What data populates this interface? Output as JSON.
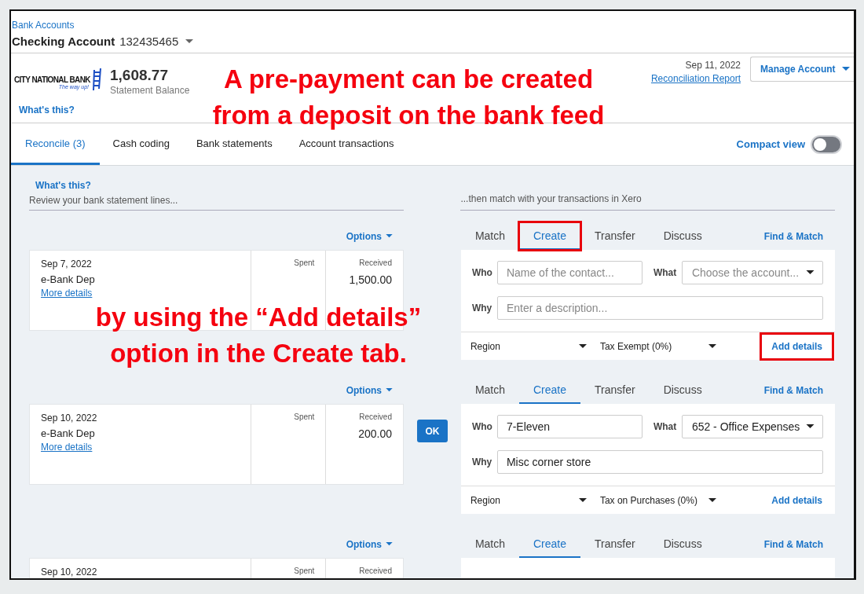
{
  "breadcrumb": "Bank Accounts",
  "account": {
    "name": "Checking Account",
    "number": "132435465"
  },
  "bank": {
    "logo_text": "CITY NATIONAL BANK",
    "tagline": "The way up!",
    "balance": "1,608.77",
    "balance_label": "Statement Balance",
    "help": "What's this?"
  },
  "statement": {
    "date": "Sep 11, 2022",
    "report_link": "Reconciliation Report",
    "manage_button": "Manage Account"
  },
  "tabs": [
    {
      "label": "Reconcile (3)",
      "selected": true
    },
    {
      "label": "Cash coding",
      "selected": false
    },
    {
      "label": "Bank statements",
      "selected": false
    },
    {
      "label": "Account transactions",
      "selected": false
    }
  ],
  "compact_view": {
    "label": "Compact view",
    "on": false
  },
  "left_help": "What's this?",
  "left_heading": "Review your bank statement lines...",
  "right_heading": "...then match with your transactions in Xero",
  "lines": [
    {
      "options": "Options",
      "date": "Sep 7, 2022",
      "description": "e-Bank Dep",
      "more": "More details",
      "spent_label": "Spent",
      "received_label": "Received",
      "received": "1,500.00",
      "match": {
        "tabs": [
          {
            "label": "Match",
            "selected": false,
            "highlighted": false
          },
          {
            "label": "Create",
            "selected": true,
            "highlighted": true
          },
          {
            "label": "Transfer",
            "selected": false,
            "highlighted": false
          },
          {
            "label": "Discuss",
            "selected": false,
            "highlighted": false
          }
        ],
        "find": "Find & Match",
        "who": {
          "label": "Who",
          "placeholder": "Name of the contact..."
        },
        "what": {
          "label": "What",
          "placeholder": "Choose the account..."
        },
        "why": {
          "label": "Why",
          "placeholder": "Enter a description..."
        },
        "region": "Region",
        "tax": "Tax Exempt (0%)",
        "add_details": {
          "label": "Add details",
          "highlighted": true
        }
      }
    },
    {
      "options": "Options",
      "date": "Sep 10, 2022",
      "description": "e-Bank Dep",
      "more": "More details",
      "spent_label": "Spent",
      "received_label": "Received",
      "received": "200.00",
      "ok": "OK",
      "match": {
        "tabs": [
          {
            "label": "Match",
            "selected": false,
            "highlighted": false
          },
          {
            "label": "Create",
            "selected": true,
            "highlighted": false
          },
          {
            "label": "Transfer",
            "selected": false,
            "highlighted": false
          },
          {
            "label": "Discuss",
            "selected": false,
            "highlighted": false
          }
        ],
        "find": "Find & Match",
        "who": {
          "label": "Who",
          "value": "7-Eleven"
        },
        "what": {
          "label": "What",
          "value": "652 - Office Expenses"
        },
        "why": {
          "label": "Why",
          "value": "Misc corner store"
        },
        "region": "Region",
        "tax": "Tax on Purchases (0%)",
        "add_details": {
          "label": "Add details",
          "highlighted": false
        }
      }
    },
    {
      "options": "Options",
      "date": "Sep 10, 2022",
      "spent_label": "Spent",
      "received_label": "Received",
      "match": {
        "tabs": [
          {
            "label": "Match",
            "selected": false,
            "highlighted": false
          },
          {
            "label": "Create",
            "selected": true,
            "highlighted": false
          },
          {
            "label": "Transfer",
            "selected": false,
            "highlighted": false
          },
          {
            "label": "Discuss",
            "selected": false,
            "highlighted": false
          }
        ],
        "find": "Find & Match"
      }
    }
  ],
  "annotations": [
    {
      "lines": [
        "A pre-payment can be created",
        "from a deposit on the bank feed"
      ]
    },
    {
      "lines": [
        "by using the “Add details”",
        "option in the Create tab."
      ]
    }
  ]
}
